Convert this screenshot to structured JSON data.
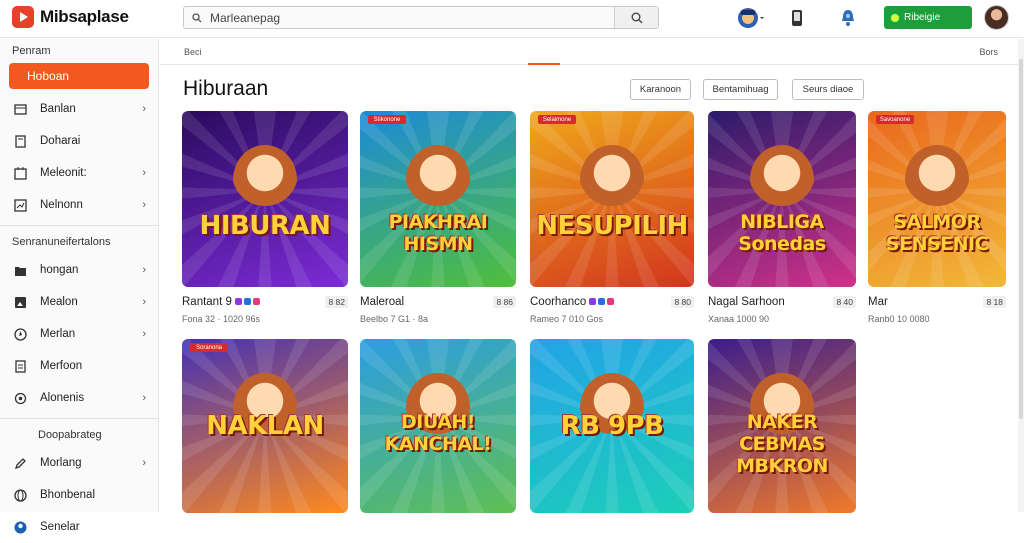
{
  "app": {
    "name": "Mibsaplase"
  },
  "search": {
    "placeholder": "Marleanepag"
  },
  "upgrade": {
    "label": "Ribeigie"
  },
  "sidebar": {
    "heading": "Penram",
    "active": "Hoboan",
    "items": [
      {
        "label": "Banlan",
        "icon": "library-icon",
        "chevron": true
      },
      {
        "label": "Doharai",
        "icon": "book-icon",
        "chevron": false
      },
      {
        "label": "Meleonit:",
        "icon": "calendar-icon",
        "chevron": true
      },
      {
        "label": "Nelnonn",
        "icon": "chart-icon",
        "chevron": true
      }
    ],
    "section2_heading": "Senranuneifertalons",
    "items2": [
      {
        "label": "hongan",
        "icon": "folder-icon",
        "chevron": true
      },
      {
        "label": "Mealon",
        "icon": "image-icon",
        "chevron": true
      },
      {
        "label": "Merlan",
        "icon": "compass-icon",
        "chevron": true
      },
      {
        "label": "Merfoon",
        "icon": "document-icon",
        "chevron": false
      },
      {
        "label": "Alonenis",
        "icon": "settings-icon",
        "chevron": true
      }
    ],
    "section3_heading": "Doopabrateg",
    "items3": [
      {
        "label": "Morlang",
        "icon": "pen-icon",
        "chevron": true
      },
      {
        "label": "Bhonbenal",
        "icon": "globe-icon",
        "chevron": false
      },
      {
        "label": "Senelar",
        "icon": "user-icon",
        "chevron": false
      }
    ]
  },
  "breadcrumb": {
    "left": "Beci",
    "right": "Bors"
  },
  "page": {
    "title": "Hiburaan"
  },
  "filters": [
    "Karanoon",
    "Bentamihuag",
    "Seurs diaoe"
  ],
  "cards": [
    {
      "thumb_text": "HIBURAN",
      "title": "Rantant 9",
      "duration": "8 82",
      "meta": "Fona 32 · 1020 96s",
      "badge": "",
      "bg": [
        "#2a0b5e",
        "#7c2bd6"
      ]
    },
    {
      "thumb_text": "PIAKHRAI HISMN",
      "title": "Maleroal",
      "duration": "8 86",
      "meta": "Beelbo 7 G1 · 8a",
      "badge": "Stikonone",
      "bg": [
        "#1c8ad9",
        "#4fbf3a"
      ]
    },
    {
      "thumb_text": "NESUPILIH",
      "title": "Coorhanco",
      "duration": "8 80",
      "meta": "Rameo 7 010 Gos",
      "badge": "Selaimone",
      "bg": [
        "#f0a81a",
        "#d2351e"
      ]
    },
    {
      "thumb_text": "NIBLIGA Sonedas",
      "title": "Nagal Sarhoon",
      "duration": "8 40",
      "meta": "Xanaa 1000 90",
      "badge": "",
      "bg": [
        "#2b1b6a",
        "#d0318a"
      ]
    },
    {
      "thumb_text": "SALMOR SENSENIC",
      "title": "Mar",
      "duration": "8 18",
      "meta": "Ranb0 10 0080",
      "badge": "Savoanone",
      "bg": [
        "#e9681c",
        "#f2b83a"
      ]
    },
    {
      "thumb_text": "NAKLAN",
      "title": "",
      "duration": "",
      "meta": "",
      "badge": "Soranona",
      "bg": [
        "#4531b3",
        "#ff8a1e"
      ]
    },
    {
      "thumb_text": "DIUAH! KANCHAL!",
      "title": "",
      "duration": "",
      "meta": "",
      "badge": "",
      "bg": [
        "#2b9de3",
        "#5fbf52"
      ]
    },
    {
      "thumb_text": "RB 9PB",
      "title": "",
      "duration": "",
      "meta": "",
      "badge": "",
      "bg": [
        "#22a3e8",
        "#1ccfb8"
      ]
    },
    {
      "thumb_text": "NAKER CEBMAS MBKRON",
      "title": "",
      "duration": "",
      "meta": "",
      "badge": "",
      "bg": [
        "#3a1c8d",
        "#f07a2a"
      ]
    }
  ]
}
